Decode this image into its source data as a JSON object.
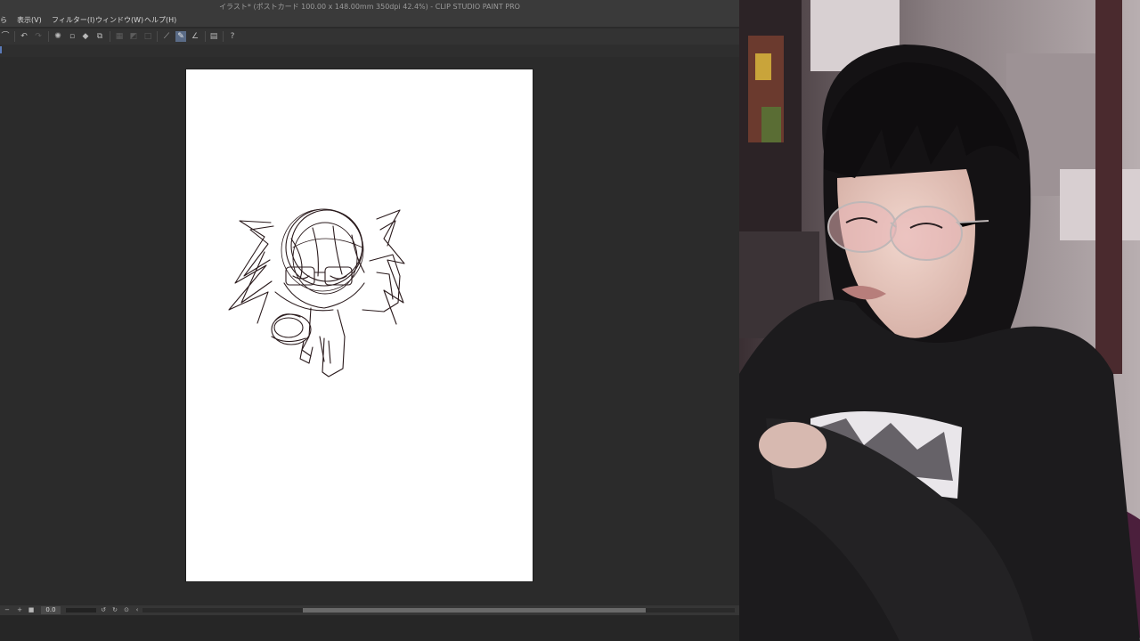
{
  "window": {
    "title": "イラスト* (ポストカード 100.00 x 148.00mm 350dpi 42.4%)  - CLIP STUDIO PAINT PRO"
  },
  "menubar": {
    "items": [
      {
        "label": "ら"
      },
      {
        "label": "表示(V)"
      },
      {
        "label": "フィルター(I)"
      },
      {
        "label": "ウィンドウ(W)"
      },
      {
        "label": "ヘルプ(H)"
      }
    ]
  },
  "toolbar": {
    "icons": [
      "lasso-icon",
      "undo-icon",
      "redo-icon",
      "clear-selection-icon",
      "fill-icon",
      "transform-icon",
      "hide-selection-icon",
      "crop-icon",
      "select-layer-icon",
      "ruler-snap-icon",
      "pen-snap-icon",
      "angle-ruler-icon",
      "material-icon",
      "help-icon"
    ]
  },
  "statusbar": {
    "zoom_value": "0.0"
  },
  "colors": {
    "app_bg": "#2b2b2b",
    "canvas_bg": "#ffffff",
    "sketch_stroke": "#2a1a1c",
    "active_tool": "#5a6b86"
  }
}
